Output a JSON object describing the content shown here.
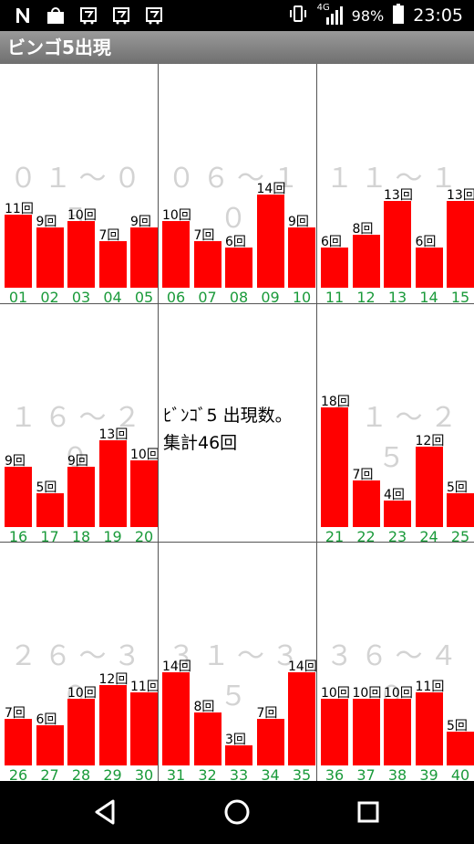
{
  "statusbar": {
    "left_icons": [
      "n-icon",
      "market-icon",
      "shopping-cart-icon",
      "shopping-cart-icon",
      "shopping-cart-icon"
    ],
    "network": "4G",
    "battery": "98%",
    "time": "23:05"
  },
  "title": "ビンゴ5出現",
  "summary": {
    "line1": "ﾋﾞﾝｺﾞ5 出現数。",
    "line2": "集計46回"
  },
  "colors": {
    "bar": "#ff0000",
    "number": "#1a9a3a",
    "range": "#d3d3d3"
  },
  "groups": [
    {
      "range": "０１～０５",
      "items": [
        {
          "n": "01",
          "count": "11回",
          "v": 11
        },
        {
          "n": "02",
          "count": "9回",
          "v": 9
        },
        {
          "n": "03",
          "count": "10回",
          "v": 10
        },
        {
          "n": "04",
          "count": "7回",
          "v": 7
        },
        {
          "n": "05",
          "count": "9回",
          "v": 9
        }
      ]
    },
    {
      "range": "０６～１０",
      "items": [
        {
          "n": "06",
          "count": "10回",
          "v": 10
        },
        {
          "n": "07",
          "count": "7回",
          "v": 7
        },
        {
          "n": "08",
          "count": "6回",
          "v": 6
        },
        {
          "n": "09",
          "count": "14回",
          "v": 14
        },
        {
          "n": "10",
          "count": "9回",
          "v": 9
        }
      ]
    },
    {
      "range": "１１～１５",
      "items": [
        {
          "n": "11",
          "count": "6回",
          "v": 6
        },
        {
          "n": "12",
          "count": "8回",
          "v": 8
        },
        {
          "n": "13",
          "count": "13回",
          "v": 13
        },
        {
          "n": "14",
          "count": "6回",
          "v": 6
        },
        {
          "n": "15",
          "count": "13回",
          "v": 13
        }
      ]
    },
    {
      "range": "１６～２０",
      "items": [
        {
          "n": "16",
          "count": "9回",
          "v": 9
        },
        {
          "n": "17",
          "count": "5回",
          "v": 5
        },
        {
          "n": "18",
          "count": "9回",
          "v": 9
        },
        {
          "n": "19",
          "count": "13回",
          "v": 13
        },
        {
          "n": "20",
          "count": "10回",
          "v": 10
        }
      ]
    },
    {
      "range": "",
      "items": []
    },
    {
      "range": "２１～２５",
      "items": [
        {
          "n": "21",
          "count": "18回",
          "v": 18
        },
        {
          "n": "22",
          "count": "7回",
          "v": 7
        },
        {
          "n": "23",
          "count": "4回",
          "v": 4
        },
        {
          "n": "24",
          "count": "12回",
          "v": 12
        },
        {
          "n": "25",
          "count": "5回",
          "v": 5
        }
      ]
    },
    {
      "range": "２６～３０",
      "items": [
        {
          "n": "26",
          "count": "7回",
          "v": 7
        },
        {
          "n": "27",
          "count": "6回",
          "v": 6
        },
        {
          "n": "28",
          "count": "10回",
          "v": 10
        },
        {
          "n": "29",
          "count": "12回",
          "v": 12
        },
        {
          "n": "30",
          "count": "11回",
          "v": 11
        }
      ]
    },
    {
      "range": "３１～３５",
      "items": [
        {
          "n": "31",
          "count": "14回",
          "v": 14
        },
        {
          "n": "32",
          "count": "8回",
          "v": 8
        },
        {
          "n": "33",
          "count": "3回",
          "v": 3
        },
        {
          "n": "34",
          "count": "7回",
          "v": 7
        },
        {
          "n": "35",
          "count": "14回",
          "v": 14
        }
      ]
    },
    {
      "range": "３６～４０",
      "items": [
        {
          "n": "36",
          "count": "10回",
          "v": 10
        },
        {
          "n": "37",
          "count": "10回",
          "v": 10
        },
        {
          "n": "38",
          "count": "10回",
          "v": 10
        },
        {
          "n": "39",
          "count": "11回",
          "v": 11
        },
        {
          "n": "40",
          "count": "5回",
          "v": 5
        }
      ]
    }
  ],
  "navbar": [
    "back-icon",
    "home-icon",
    "recents-icon"
  ]
}
